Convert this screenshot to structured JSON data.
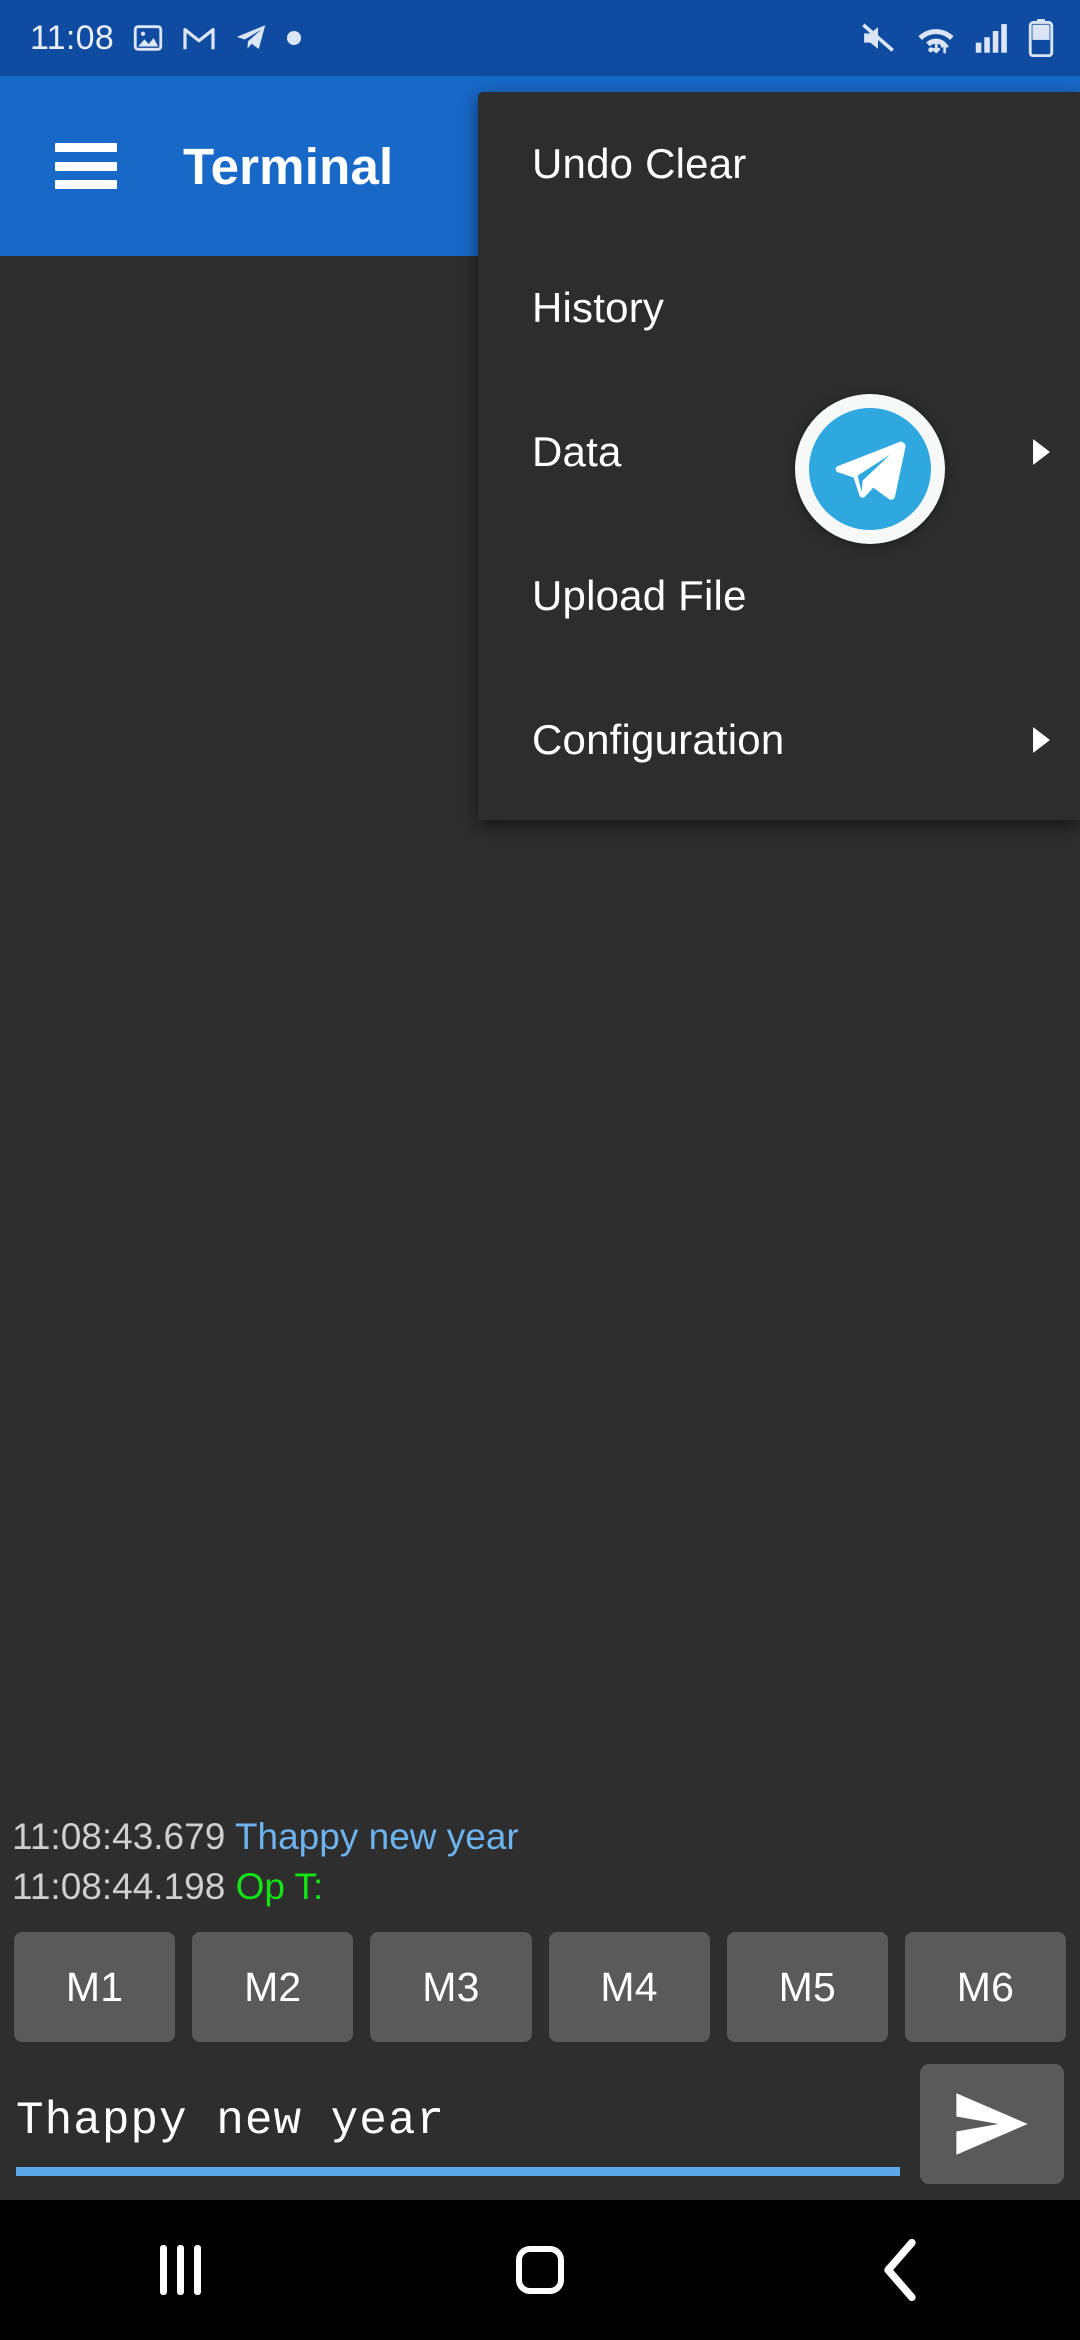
{
  "status_bar": {
    "clock": "11:08",
    "left_icons": [
      "gallery-icon",
      "gmail-icon",
      "telegram-icon",
      "dot-icon"
    ],
    "right_icons": [
      "mute-icon",
      "wifi-icon",
      "signal-icon",
      "battery-icon"
    ],
    "background_color": "#0f4ba0"
  },
  "app_bar": {
    "title": "Terminal",
    "menu_icon": "hamburger-icon",
    "background_color": "#1868c8"
  },
  "menu": {
    "background_color": "#2d2d2d",
    "items": [
      {
        "label": "Undo Clear",
        "has_submenu": false
      },
      {
        "label": "History",
        "has_submenu": false
      },
      {
        "label": "Data",
        "has_submenu": true
      },
      {
        "label": "Upload File",
        "has_submenu": false
      },
      {
        "label": "Configuration",
        "has_submenu": true
      }
    ]
  },
  "floating_bubble": {
    "icon": "telegram-icon",
    "ring_color": "#f7f8f8",
    "circle_color": "#2fa8e0"
  },
  "terminal": {
    "background_color": "#2e2e2e",
    "lines": [
      {
        "timestamp": "11:08:43.679",
        "message": "Thappy new year",
        "message_color": "#6db3ee"
      },
      {
        "timestamp": "11:08:44.198",
        "message": "Op T:",
        "message_color": "#14e214"
      }
    ]
  },
  "macros": {
    "buttons": [
      "M1",
      "M2",
      "M3",
      "M4",
      "M5",
      "M6"
    ],
    "button_color": "#5a5a5a"
  },
  "input": {
    "value": "Thappy new year",
    "placeholder": "",
    "underline_color": "#5da8e8",
    "send_icon": "send-icon"
  },
  "nav_bar": {
    "buttons": [
      "recents-icon",
      "home-icon",
      "back-icon"
    ],
    "background_color": "#000000"
  }
}
